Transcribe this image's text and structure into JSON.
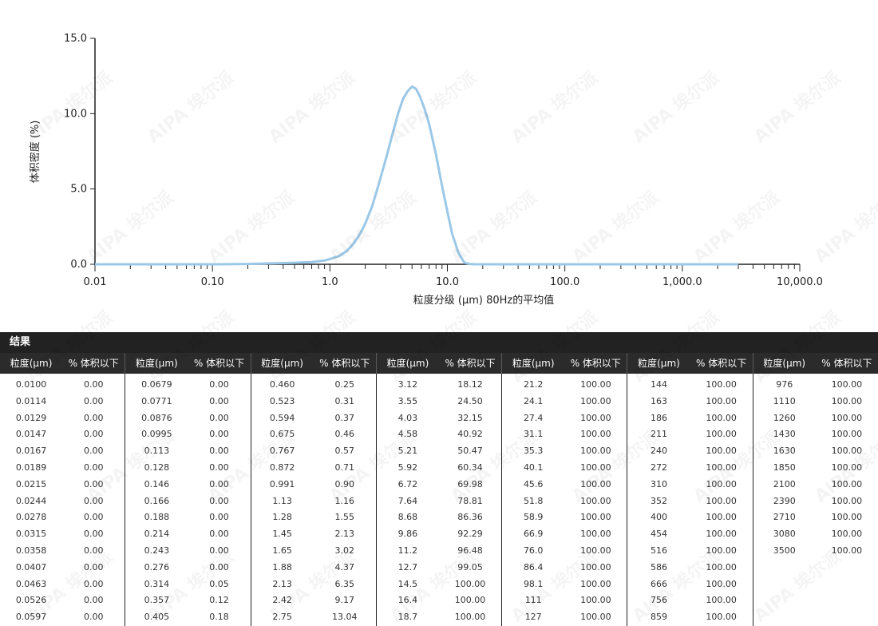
{
  "chart_data": {
    "type": "line",
    "xscale": "log",
    "xlim": [
      0.01,
      10000
    ],
    "ylim": [
      0,
      15
    ],
    "xticks": [
      "0.01",
      "0.10",
      "1.0",
      "10.0",
      "100.0",
      "1,000.0",
      "10,000.0"
    ],
    "yticks": [
      "0.0",
      "5.0",
      "10.0",
      "15.0"
    ],
    "xlabel": "粒度分级 (µm)  80Hz的平均值",
    "ylabel": "体积密度 (%)",
    "grid": false,
    "series": [
      {
        "color": "#9cc8e8",
        "x": [
          0.01,
          0.1,
          0.2,
          0.3,
          0.5,
          0.7,
          0.9,
          1.0,
          1.2,
          1.4,
          1.6,
          1.8,
          2.0,
          2.3,
          2.6,
          3.0,
          3.4,
          3.8,
          4.2,
          4.6,
          5.0,
          5.4,
          5.8,
          6.4,
          7.0,
          8.0,
          9.0,
          10.0,
          11.0,
          12.5,
          14.0,
          15.5,
          17.0,
          20.0,
          50.0,
          100.0,
          1000.0,
          3000.0
        ],
        "y": [
          0.0,
          0.0,
          0.02,
          0.06,
          0.1,
          0.15,
          0.25,
          0.35,
          0.55,
          0.9,
          1.4,
          2.0,
          2.7,
          3.9,
          5.3,
          7.0,
          8.6,
          10.0,
          11.0,
          11.5,
          11.8,
          11.65,
          11.2,
          10.3,
          9.3,
          7.3,
          5.2,
          3.5,
          2.0,
          0.7,
          0.1,
          0.02,
          0.0,
          0.0,
          0.0,
          0.0,
          0.0,
          0.0
        ]
      }
    ]
  },
  "results": {
    "title": "结果",
    "col_size": "粒度(µm)",
    "col_pct": "% 体积以下",
    "groups": [
      {
        "rows": [
          [
            "0.0100",
            "0.00"
          ],
          [
            "0.0114",
            "0.00"
          ],
          [
            "0.0129",
            "0.00"
          ],
          [
            "0.0147",
            "0.00"
          ],
          [
            "0.0167",
            "0.00"
          ],
          [
            "0.0189",
            "0.00"
          ],
          [
            "0.0215",
            "0.00"
          ],
          [
            "0.0244",
            "0.00"
          ],
          [
            "0.0278",
            "0.00"
          ],
          [
            "0.0315",
            "0.00"
          ],
          [
            "0.0358",
            "0.00"
          ],
          [
            "0.0407",
            "0.00"
          ],
          [
            "0.0463",
            "0.00"
          ],
          [
            "0.0526",
            "0.00"
          ],
          [
            "0.0597",
            "0.00"
          ]
        ]
      },
      {
        "rows": [
          [
            "0.0679",
            "0.00"
          ],
          [
            "0.0771",
            "0.00"
          ],
          [
            "0.0876",
            "0.00"
          ],
          [
            "0.0995",
            "0.00"
          ],
          [
            "0.113",
            "0.00"
          ],
          [
            "0.128",
            "0.00"
          ],
          [
            "0.146",
            "0.00"
          ],
          [
            "0.166",
            "0.00"
          ],
          [
            "0.188",
            "0.00"
          ],
          [
            "0.214",
            "0.00"
          ],
          [
            "0.243",
            "0.00"
          ],
          [
            "0.276",
            "0.00"
          ],
          [
            "0.314",
            "0.05"
          ],
          [
            "0.357",
            "0.12"
          ],
          [
            "0.405",
            "0.18"
          ]
        ]
      },
      {
        "rows": [
          [
            "0.460",
            "0.25"
          ],
          [
            "0.523",
            "0.31"
          ],
          [
            "0.594",
            "0.37"
          ],
          [
            "0.675",
            "0.46"
          ],
          [
            "0.767",
            "0.57"
          ],
          [
            "0.872",
            "0.71"
          ],
          [
            "0.991",
            "0.90"
          ],
          [
            "1.13",
            "1.16"
          ],
          [
            "1.28",
            "1.55"
          ],
          [
            "1.45",
            "2.13"
          ],
          [
            "1.65",
            "3.02"
          ],
          [
            "1.88",
            "4.37"
          ],
          [
            "2.13",
            "6.35"
          ],
          [
            "2.42",
            "9.17"
          ],
          [
            "2.75",
            "13.04"
          ]
        ]
      },
      {
        "rows": [
          [
            "3.12",
            "18.12"
          ],
          [
            "3.55",
            "24.50"
          ],
          [
            "4.03",
            "32.15"
          ],
          [
            "4.58",
            "40.92"
          ],
          [
            "5.21",
            "50.47"
          ],
          [
            "5.92",
            "60.34"
          ],
          [
            "6.72",
            "69.98"
          ],
          [
            "7.64",
            "78.81"
          ],
          [
            "8.68",
            "86.36"
          ],
          [
            "9.86",
            "92.29"
          ],
          [
            "11.2",
            "96.48"
          ],
          [
            "12.7",
            "99.05"
          ],
          [
            "14.5",
            "100.00"
          ],
          [
            "16.4",
            "100.00"
          ],
          [
            "18.7",
            "100.00"
          ]
        ]
      },
      {
        "rows": [
          [
            "21.2",
            "100.00"
          ],
          [
            "24.1",
            "100.00"
          ],
          [
            "27.4",
            "100.00"
          ],
          [
            "31.1",
            "100.00"
          ],
          [
            "35.3",
            "100.00"
          ],
          [
            "40.1",
            "100.00"
          ],
          [
            "45.6",
            "100.00"
          ],
          [
            "51.8",
            "100.00"
          ],
          [
            "58.9",
            "100.00"
          ],
          [
            "66.9",
            "100.00"
          ],
          [
            "76.0",
            "100.00"
          ],
          [
            "86.4",
            "100.00"
          ],
          [
            "98.1",
            "100.00"
          ],
          [
            "111",
            "100.00"
          ],
          [
            "127",
            "100.00"
          ]
        ]
      },
      {
        "rows": [
          [
            "144",
            "100.00"
          ],
          [
            "163",
            "100.00"
          ],
          [
            "186",
            "100.00"
          ],
          [
            "211",
            "100.00"
          ],
          [
            "240",
            "100.00"
          ],
          [
            "272",
            "100.00"
          ],
          [
            "310",
            "100.00"
          ],
          [
            "352",
            "100.00"
          ],
          [
            "400",
            "100.00"
          ],
          [
            "454",
            "100.00"
          ],
          [
            "516",
            "100.00"
          ],
          [
            "586",
            "100.00"
          ],
          [
            "666",
            "100.00"
          ],
          [
            "756",
            "100.00"
          ],
          [
            "859",
            "100.00"
          ]
        ]
      },
      {
        "rows": [
          [
            "976",
            "100.00"
          ],
          [
            "1110",
            "100.00"
          ],
          [
            "1260",
            "100.00"
          ],
          [
            "1430",
            "100.00"
          ],
          [
            "1630",
            "100.00"
          ],
          [
            "1850",
            "100.00"
          ],
          [
            "2100",
            "100.00"
          ],
          [
            "2390",
            "100.00"
          ],
          [
            "2710",
            "100.00"
          ],
          [
            "3080",
            "100.00"
          ],
          [
            "3500",
            "100.00"
          ]
        ]
      }
    ]
  },
  "watermark": "AIPA 埃尔派"
}
